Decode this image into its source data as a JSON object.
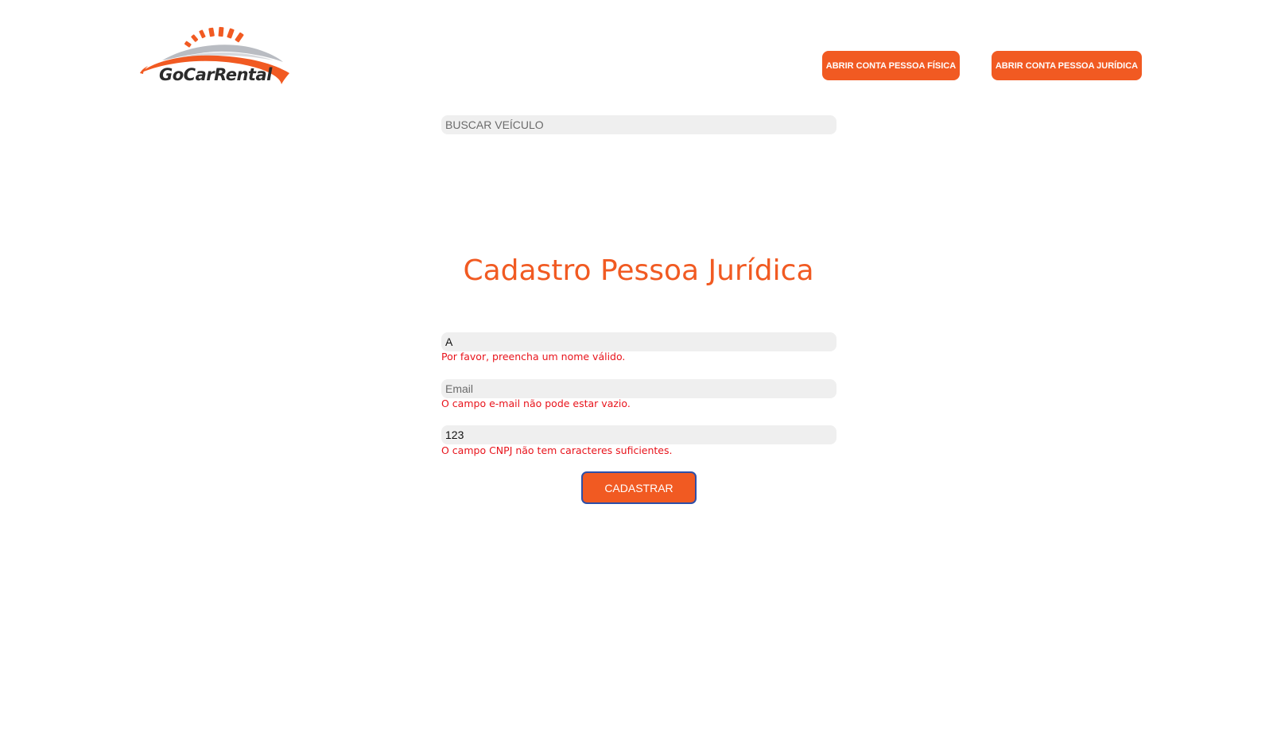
{
  "brand": {
    "name": "GoCarRental",
    "accent_color": "#f15a22",
    "swoosh_gray": "#b9bcc2",
    "text_color": "#2b2b2b"
  },
  "header": {
    "btn_pessoa_fisica": "ABRIR CONTA PESSOA FÍSICA",
    "btn_pessoa_juridica": "ABRIR CONTA PESSOA JURÍDICA"
  },
  "search": {
    "placeholder": "BUSCAR VEÍCULO",
    "value": ""
  },
  "form": {
    "title": "Cadastro Pessoa Jurídica",
    "name": {
      "value": "A",
      "error": "Por favor, preencha um nome válido."
    },
    "email": {
      "placeholder": "Email",
      "value": "",
      "error": "O campo e-mail não pode estar vazio."
    },
    "cnpj": {
      "value": "123",
      "error": "O campo CNPJ não tem caracteres suficientes."
    },
    "submit_label": "CADASTRAR",
    "error_color": "#e8131b"
  }
}
